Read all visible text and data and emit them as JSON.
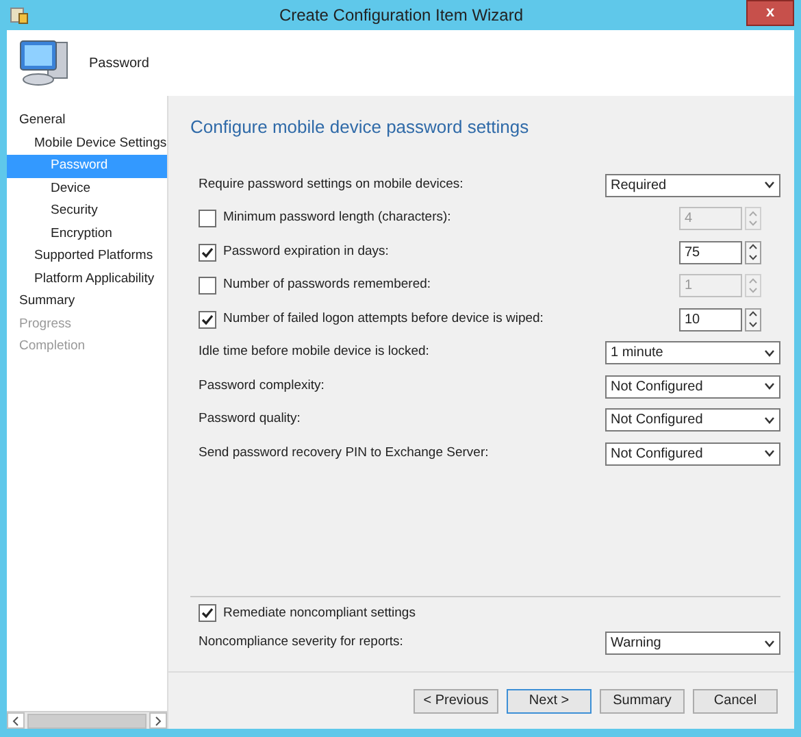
{
  "window": {
    "title": "Create Configuration Item Wizard",
    "close_label": "x"
  },
  "header": {
    "title": "Password"
  },
  "sidebar": {
    "items": [
      {
        "label": "General",
        "selected": false,
        "disabled": false,
        "children": [
          {
            "label": "Mobile Device Settings",
            "selected": false,
            "disabled": false,
            "children": [
              {
                "label": "Password",
                "selected": true,
                "disabled": false
              },
              {
                "label": "Device",
                "selected": false,
                "disabled": false
              },
              {
                "label": "Security",
                "selected": false,
                "disabled": false
              },
              {
                "label": "Encryption",
                "selected": false,
                "disabled": false
              }
            ]
          },
          {
            "label": "Supported Platforms",
            "selected": false,
            "disabled": false
          },
          {
            "label": "Platform Applicability",
            "selected": false,
            "disabled": false
          }
        ]
      },
      {
        "label": "Summary",
        "selected": false,
        "disabled": false
      },
      {
        "label": "Progress",
        "selected": false,
        "disabled": true
      },
      {
        "label": "Completion",
        "selected": false,
        "disabled": true
      }
    ]
  },
  "page": {
    "heading": "Configure mobile device password settings",
    "settings": [
      {
        "kind": "dropdown",
        "label": "Require password settings on mobile devices:",
        "value": "Required"
      },
      {
        "kind": "spin",
        "label": "Minimum password length (characters):",
        "checked": false,
        "value": "4"
      },
      {
        "kind": "spin",
        "label": "Password expiration in days:",
        "checked": true,
        "value": "75"
      },
      {
        "kind": "spin",
        "label": "Number of passwords remembered:",
        "checked": false,
        "value": "1"
      },
      {
        "kind": "spin",
        "label": "Number of failed logon attempts before device is wiped:",
        "checked": true,
        "value": "10"
      },
      {
        "kind": "dropdown",
        "label": "Idle time before mobile device is locked:",
        "value": "1 minute"
      },
      {
        "kind": "dropdown",
        "label": "Password complexity:",
        "value": "Not Configured"
      },
      {
        "kind": "dropdown",
        "label": "Password quality:",
        "value": "Not Configured"
      },
      {
        "kind": "dropdown",
        "label": "Send password recovery PIN to Exchange Server:",
        "value": "Not Configured"
      }
    ],
    "remediate": {
      "label": "Remediate noncompliant settings",
      "checked": true
    },
    "severity": {
      "label": "Noncompliance severity for reports:",
      "value": "Warning"
    }
  },
  "buttons": [
    {
      "label": "< Previous",
      "selected": false
    },
    {
      "label": "Next >",
      "selected": true
    },
    {
      "label": "Summary",
      "selected": false
    },
    {
      "label": "Cancel",
      "selected": false
    }
  ]
}
